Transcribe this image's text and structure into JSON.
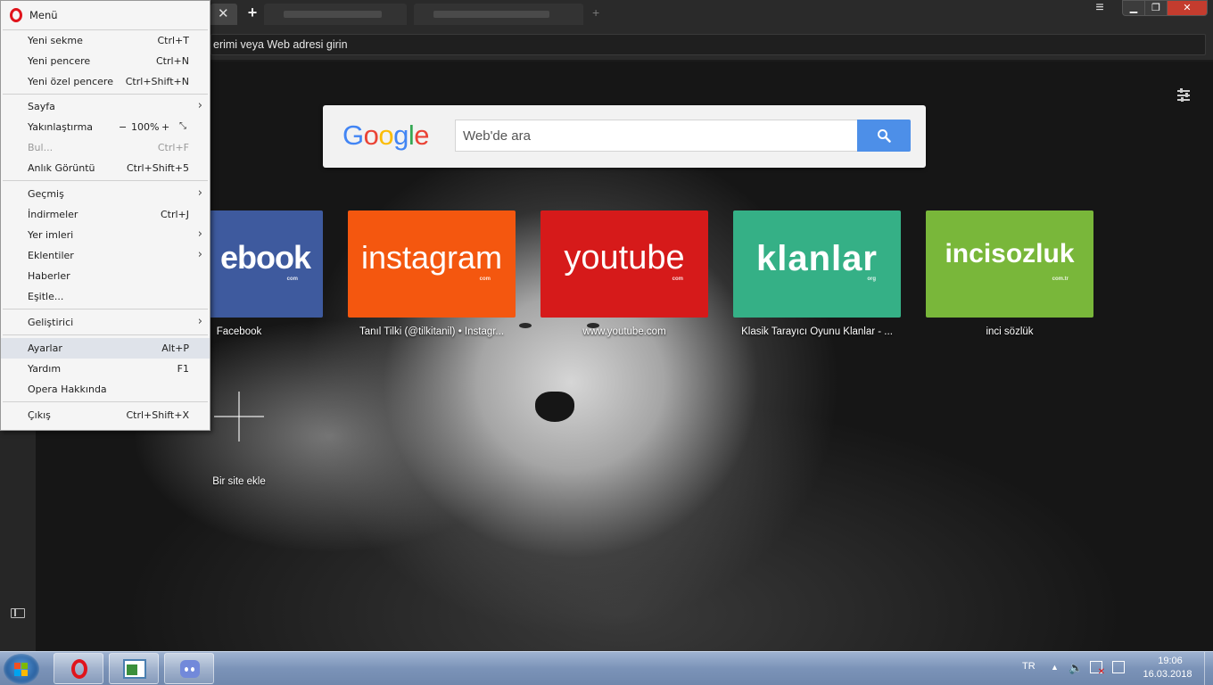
{
  "browser": {
    "address_text": "erimi veya Web adresi girin"
  },
  "menu": {
    "title": "Menü",
    "items": [
      {
        "label": "Yeni sekme",
        "shortcut": "Ctrl+T"
      },
      {
        "label": "Yeni pencere",
        "shortcut": "Ctrl+N"
      },
      {
        "label": "Yeni özel pencere",
        "shortcut": "Ctrl+Shift+N"
      },
      {
        "label": "Sayfa",
        "shortcut": ""
      },
      {
        "label": "Yakınlaştırma",
        "shortcut": ""
      },
      {
        "label": "Bul...",
        "shortcut": "Ctrl+F"
      },
      {
        "label": "Anlık Görüntü",
        "shortcut": "Ctrl+Shift+5"
      },
      {
        "label": "Geçmiş",
        "shortcut": ""
      },
      {
        "label": "İndirmeler",
        "shortcut": "Ctrl+J"
      },
      {
        "label": "Yer imleri",
        "shortcut": ""
      },
      {
        "label": "Eklentiler",
        "shortcut": ""
      },
      {
        "label": "Haberler",
        "shortcut": ""
      },
      {
        "label": "Eşitle...",
        "shortcut": ""
      },
      {
        "label": "Geliştirici",
        "shortcut": ""
      },
      {
        "label": "Ayarlar",
        "shortcut": "Alt+P"
      },
      {
        "label": "Yardım",
        "shortcut": "F1"
      },
      {
        "label": "Opera Hakkında",
        "shortcut": ""
      },
      {
        "label": "Çıkış",
        "shortcut": "Ctrl+Shift+X"
      }
    ],
    "zoom": {
      "minus": "−",
      "level": "100%",
      "plus": "+"
    }
  },
  "search": {
    "logo_letters": [
      "G",
      "o",
      "o",
      "g",
      "l",
      "e"
    ],
    "placeholder": "Web'de ara"
  },
  "speed_dial": [
    {
      "brand": "ebook",
      "sub": "com",
      "caption": "Facebook",
      "color": "#3e5a9e"
    },
    {
      "brand": "instagram",
      "sub": "com",
      "caption": "Tanıl Tilki (@tilkitanil) • Instagr...",
      "color": "#f4570f"
    },
    {
      "brand": "youtube",
      "sub": "com",
      "caption": "www.youtube.com",
      "color": "#d61a1a"
    },
    {
      "brand": "klanlar",
      "sub": "org",
      "caption": "Klasik Tarayıcı Oyunu Klanlar - ...",
      "color": "#35b086"
    },
    {
      "brand": "incisozluk",
      "sub": "com.tr",
      "caption": "inci sözlük",
      "color": "#79b73a"
    }
  ],
  "add_site_label": "Bir site ekle",
  "taskbar": {
    "language": "TR",
    "time": "19:06",
    "date": "16.03.2018"
  }
}
